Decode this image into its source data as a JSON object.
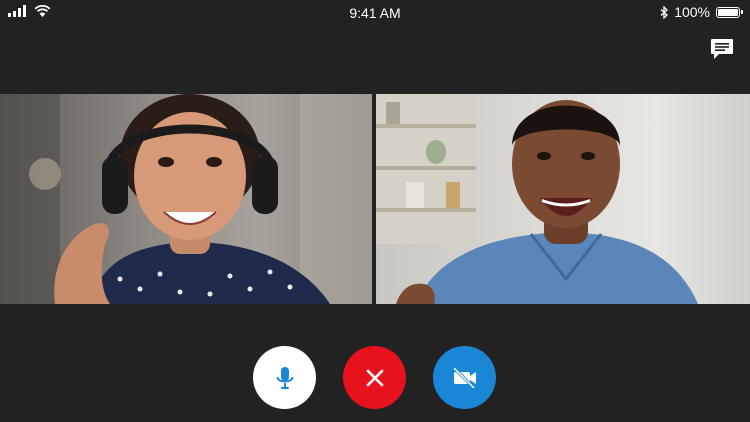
{
  "status_bar": {
    "time": "9:41 AM",
    "battery_label": "100%",
    "battery_level": 1.0,
    "icons": [
      "signal-bars-icon",
      "wifi-icon",
      "bluetooth-icon",
      "battery-icon"
    ]
  },
  "header": {
    "chat_icon": "chat-bubble-icon"
  },
  "participants": [
    {
      "position": "left",
      "description_icon": "video-feed"
    },
    {
      "position": "right",
      "description_icon": "video-feed"
    }
  ],
  "controls": {
    "mic_icon": "microphone-icon",
    "end_call_icon": "close-icon",
    "camera_icon": "video-off-icon"
  },
  "colors": {
    "background": "#222222",
    "mic_button": "#ffffff",
    "mic_icon": "#1a87d6",
    "end_call_button": "#e8121e",
    "camera_button": "#1a87d6"
  }
}
